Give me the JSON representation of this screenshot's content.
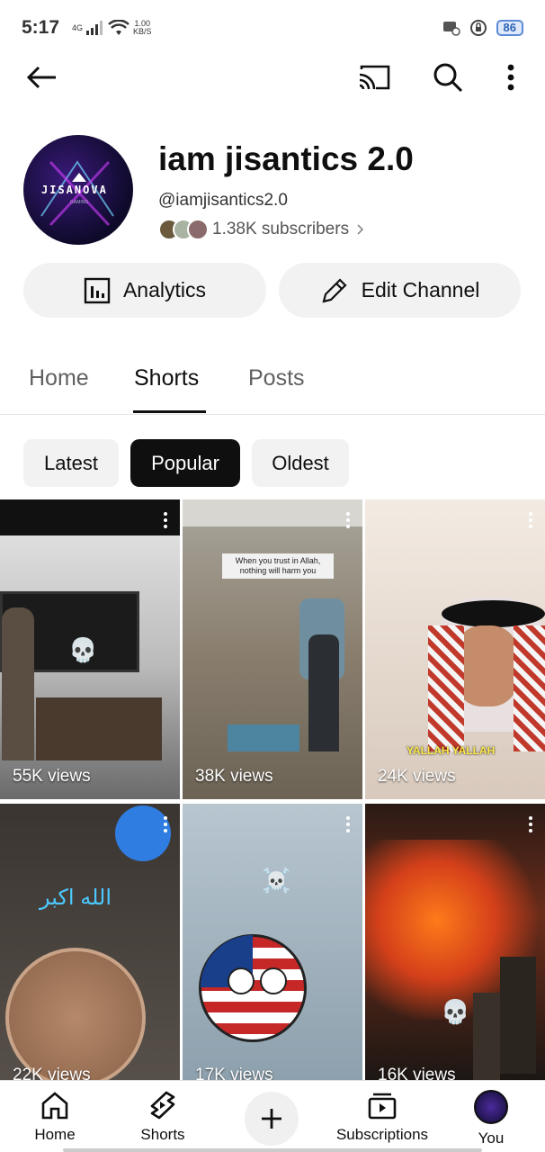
{
  "status": {
    "time": "5:17",
    "net_type": "4G",
    "speed_value": "1.00",
    "speed_unit": "KB/S",
    "battery": "86"
  },
  "channel": {
    "name": "iam jisantics 2.0",
    "handle": "@iamjisantics2.0",
    "subscribers": "1.38K subscribers",
    "avatar_text": "JISANOVA",
    "avatar_sub": "GAMING"
  },
  "actions": {
    "analytics": "Analytics",
    "edit": "Edit Channel"
  },
  "tabs": [
    {
      "label": "Home"
    },
    {
      "label": "Shorts"
    },
    {
      "label": "Posts"
    }
  ],
  "chips": [
    {
      "label": "Latest"
    },
    {
      "label": "Popular"
    },
    {
      "label": "Oldest"
    }
  ],
  "shorts": [
    {
      "views": "55K views",
      "caption": ""
    },
    {
      "views": "38K views",
      "caption": "When you trust in Allah, nothing will harm you"
    },
    {
      "views": "24K views",
      "caption": "YALLAH YALLAH"
    },
    {
      "views": "22K views",
      "caption": "الله اكبر"
    },
    {
      "views": "17K views",
      "caption": ""
    },
    {
      "views": "16K views",
      "caption": ""
    }
  ],
  "nav": [
    {
      "label": "Home"
    },
    {
      "label": "Shorts"
    },
    {
      "label": "Subscriptions"
    },
    {
      "label": "You"
    }
  ],
  "colors": {
    "accent": "#0f0f0f",
    "chip_bg": "#f2f2f2",
    "battery": "#5b8bd8"
  }
}
